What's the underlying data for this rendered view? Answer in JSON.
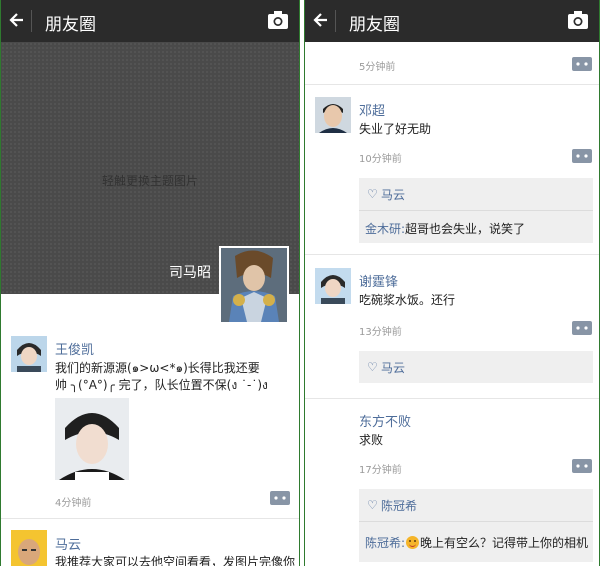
{
  "left": {
    "title": "朋友圈",
    "cover_hint": "轻触更换主题图片",
    "owner_name": "司马昭",
    "posts": [
      {
        "name": "王俊凯",
        "text_line1": "我们的新源源(๑>ω<*๑)长得比我还要",
        "text_line2": "帅 ╮(°A°)╭ 完了，队长位置不保(ง ˙-˙)ง",
        "time": "4分钟前"
      },
      {
        "name": "马云",
        "text": "我推荐大家可以去他空间看看，发图片完像你"
      }
    ]
  },
  "right": {
    "title": "朋友圈",
    "first_time": "5分钟前",
    "posts": [
      {
        "name": "邓超",
        "text": "失业了好无助",
        "time": "10分钟前",
        "like": "马云",
        "comment_name": "金木研:",
        "comment_text": "超哥也会失业，说笑了"
      },
      {
        "name": "谢霆锋",
        "text": "吃碗浆水饭。还行",
        "time": "13分钟前",
        "like": "马云"
      },
      {
        "name": "东方不败",
        "text": "求败",
        "time": "17分钟前",
        "like": "陈冠希",
        "comment_name": "陈冠希:",
        "comment_text": "晚上有空么？记得带上你的相机"
      }
    ]
  },
  "icons": {
    "back": "back-arrow-icon",
    "camera": "camera-icon",
    "comment": "comment-bubble-icon",
    "heart": "heart-icon",
    "emoji": "smiley-emoji-icon"
  },
  "colors": {
    "topbar": "#2b2b2b",
    "name": "#4e6d9a",
    "border": "#2f7a2f"
  }
}
